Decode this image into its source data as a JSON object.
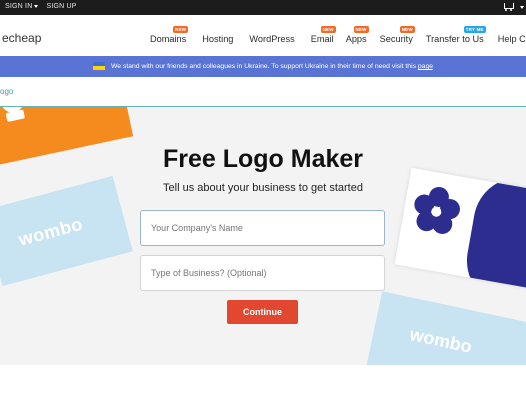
{
  "topbar": {
    "sign_in": "SIGN IN",
    "sign_up": "SIGN UP"
  },
  "logo_text": "echeap",
  "nav": [
    {
      "label": "Domains",
      "badge": "NEW",
      "badge_color": "#f26b26"
    },
    {
      "label": "Hosting",
      "badge": ""
    },
    {
      "label": "WordPress",
      "badge": ""
    },
    {
      "label": "Email",
      "badge": "NEW",
      "badge_color": "#f26b26"
    },
    {
      "label": "Apps",
      "badge": "NEW",
      "badge_color": "#f26b26"
    },
    {
      "label": "Security",
      "badge": "NEW",
      "badge_color": "#f26b26"
    },
    {
      "label": "Transfer to Us",
      "badge": "TRY ME",
      "badge_color": "#2aa5e8"
    },
    {
      "label": "Help Cente",
      "badge": ""
    }
  ],
  "banner": {
    "text": "We stand with our friends and colleagues in Ukraine. To support Ukraine in their time of need visit this ",
    "link": "page"
  },
  "breadcrumb": "ogo",
  "main": {
    "title": "Free Logo Maker",
    "subtitle": "Tell us about your business to get started",
    "company_placeholder": "Your Company's Name",
    "business_placeholder": "Type of Business? (Optional)",
    "continue_label": "Continue",
    "card_text_1": "wombo",
    "card_text_2": "wombo"
  }
}
